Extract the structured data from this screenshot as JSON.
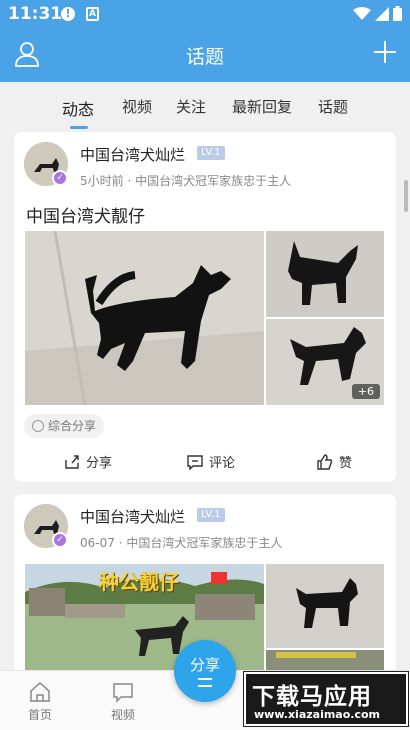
{
  "status_bar": {
    "time": "11:31"
  },
  "header": {
    "title": "话题"
  },
  "tabs": [
    {
      "label": "动态",
      "active": true
    },
    {
      "label": "视频"
    },
    {
      "label": "关注"
    },
    {
      "label": "最新回复"
    },
    {
      "label": "话题"
    }
  ],
  "posts": [
    {
      "author": "中国台湾犬灿烂",
      "level": "LV.1",
      "meta": "5小时前 · 中国台湾犬冠军家族忠于主人",
      "title": "中国台湾犬靓仔",
      "more_count": "+6",
      "tag": "综合分享",
      "actions": {
        "share": "分享",
        "comment": "评论",
        "like": "赞"
      }
    },
    {
      "author": "中国台湾犬灿烂",
      "level": "LV.1",
      "meta": "06-07 · 中国台湾犬冠军家族忠于主人",
      "image_caption": "种公靓仔"
    }
  ],
  "bottom_nav": {
    "home": "首页",
    "video": "视频",
    "share": "分享"
  },
  "watermark": {
    "brand": "下载马应用",
    "url": "www.xiazaimao.com"
  },
  "colors": {
    "accent": "#4aa3e7",
    "fab": "#2ea4ea",
    "badge": "#a974e6"
  }
}
